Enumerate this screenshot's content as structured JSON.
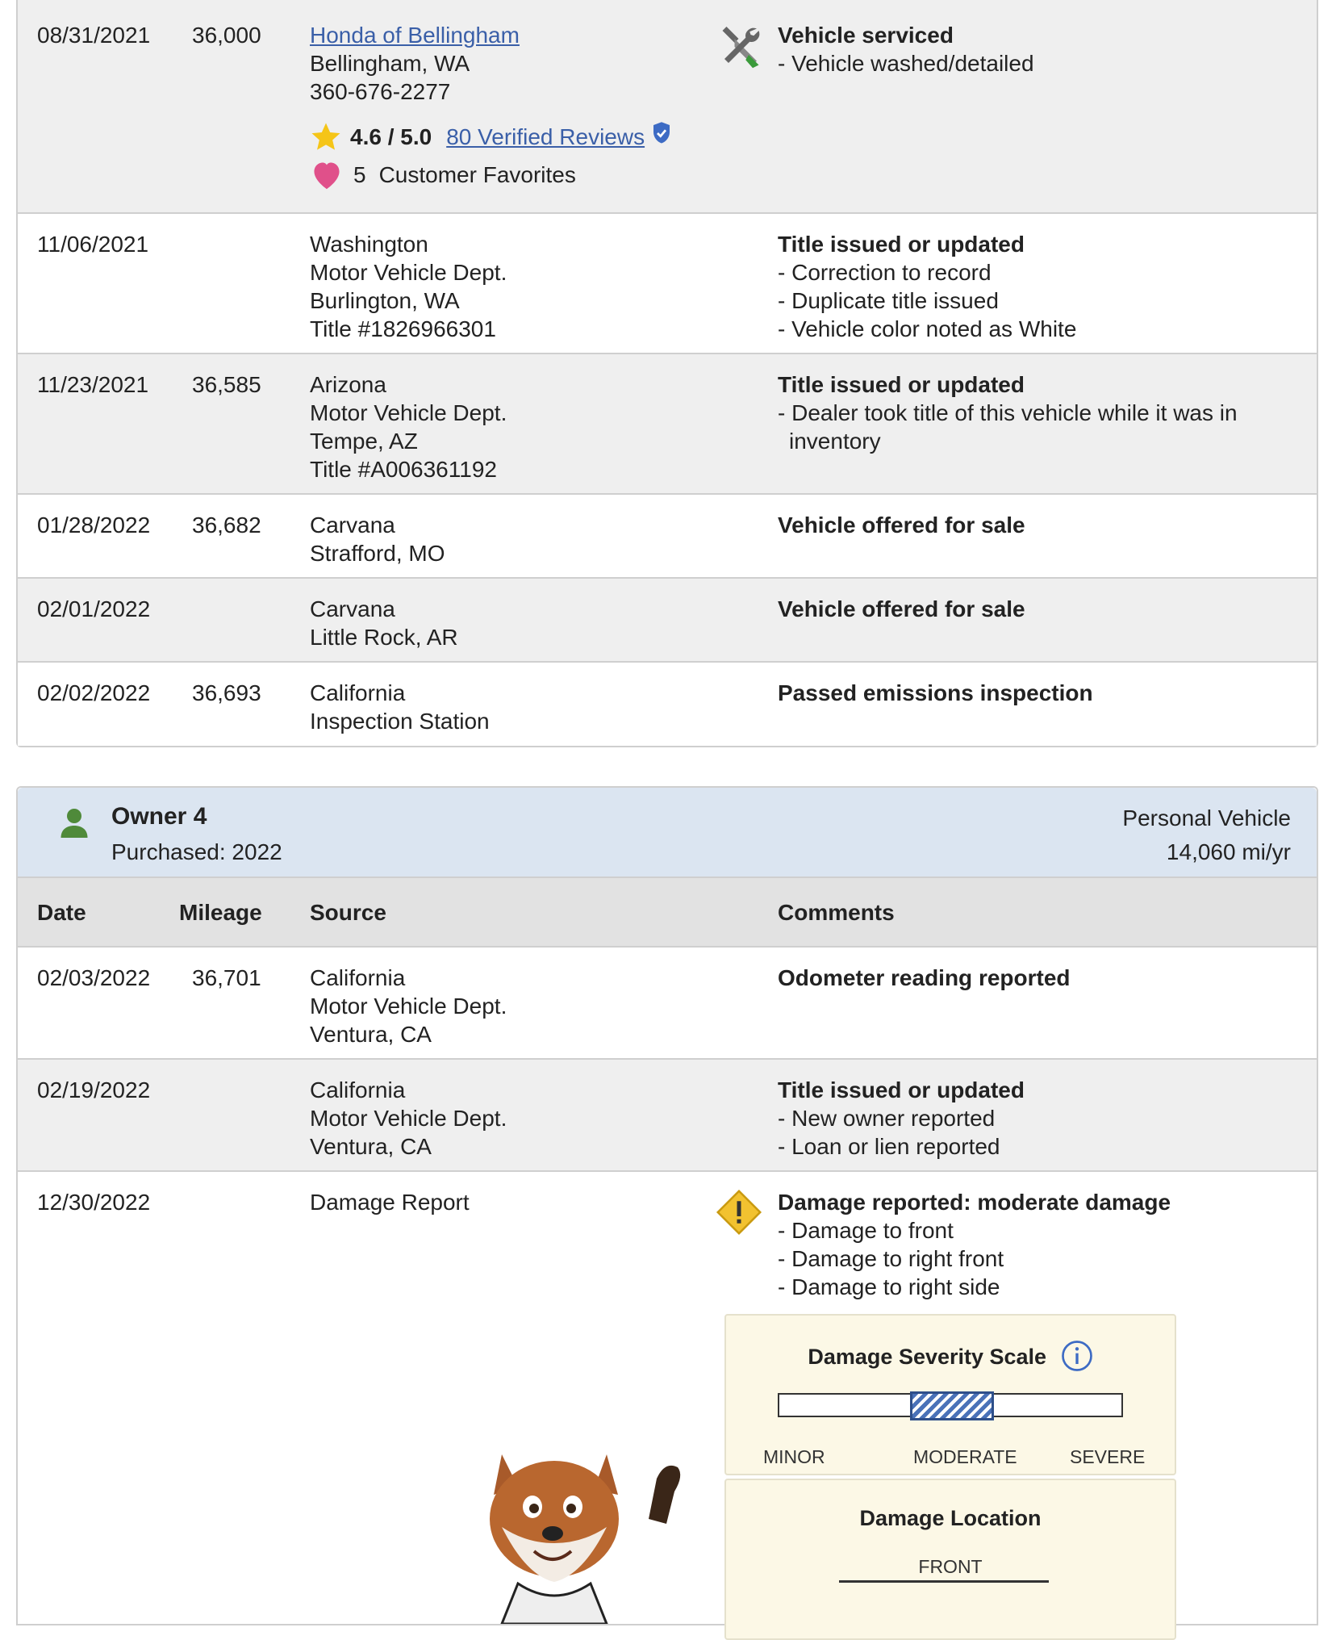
{
  "history_rows": [
    {
      "date": "08/31/2021",
      "mileage": "36,000",
      "source": {
        "link": "Honda of Bellingham",
        "lines": [
          "Bellingham, WA",
          "360-676-2277"
        ],
        "rating": "4.6 / 5.0",
        "reviews_link": "80 Verified Reviews",
        "favorites_count": "5",
        "favorites_label": "Customer Favorites"
      },
      "icon": "service-tools-icon",
      "comment_title": "Vehicle serviced",
      "comment_items": [
        "- Vehicle washed/detailed"
      ]
    },
    {
      "date": "11/06/2021",
      "mileage": "",
      "source_lines": [
        "Washington",
        "Motor Vehicle Dept.",
        "Burlington, WA",
        "Title #1826966301"
      ],
      "comment_title": "Title issued or updated",
      "comment_items": [
        "- Correction to record",
        "- Duplicate title issued",
        "- Vehicle color noted as White"
      ]
    },
    {
      "date": "11/23/2021",
      "mileage": "36,585",
      "source_lines": [
        "Arizona",
        "Motor Vehicle Dept.",
        "Tempe, AZ",
        "Title #A006361192"
      ],
      "comment_title": "Title issued or updated",
      "comment_items": [
        "- Dealer took title of this vehicle while it was in inventory"
      ]
    },
    {
      "date": "01/28/2022",
      "mileage": "36,682",
      "source_lines": [
        "Carvana",
        "Strafford, MO"
      ],
      "comment_title": "Vehicle offered for sale",
      "comment_items": []
    },
    {
      "date": "02/01/2022",
      "mileage": "",
      "source_lines": [
        "Carvana",
        "Little Rock, AR"
      ],
      "comment_title": "Vehicle offered for sale",
      "comment_items": []
    },
    {
      "date": "02/02/2022",
      "mileage": "36,693",
      "source_lines": [
        "California",
        "Inspection Station"
      ],
      "comment_title": "Passed emissions inspection",
      "comment_items": []
    }
  ],
  "owner": {
    "title": "Owner 4",
    "purchased": "Purchased: 2022",
    "vehicle_type": "Personal Vehicle",
    "annual_miles": "14,060 mi/yr",
    "icon": "person-icon"
  },
  "columns": {
    "date": "Date",
    "mileage": "Mileage",
    "source": "Source",
    "comments": "Comments"
  },
  "owner_rows": [
    {
      "date": "02/03/2022",
      "mileage": "36,701",
      "source_lines": [
        "California",
        "Motor Vehicle Dept.",
        "Ventura, CA"
      ],
      "comment_title": "Odometer reading reported",
      "comment_items": []
    },
    {
      "date": "02/19/2022",
      "mileage": "",
      "source_lines": [
        "California",
        "Motor Vehicle Dept.",
        "Ventura, CA"
      ],
      "comment_title": "Title issued or updated",
      "comment_items": [
        "- New owner reported",
        "- Loan or lien reported"
      ]
    },
    {
      "date": "12/30/2022",
      "mileage": "",
      "source_lines": [
        "Damage Report"
      ],
      "icon": "warning-diamond-icon",
      "comment_title": "Damage reported: moderate damage",
      "comment_items": [
        "- Damage to front",
        "- Damage to right front",
        "- Damage to right side"
      ]
    }
  ],
  "damage_severity": {
    "title": "Damage Severity Scale",
    "levels": [
      "MINOR",
      "MODERATE",
      "SEVERE"
    ],
    "selected": "MODERATE",
    "icon": "info-icon"
  },
  "damage_location": {
    "title": "Damage Location",
    "front_label": "FRONT"
  },
  "mascot": "fox-mascot-icon",
  "colors": {
    "link": "#3a5fa8",
    "owner_header_bg": "#dbe5f1",
    "row_shaded": "#efefef",
    "star": "#f5c518",
    "heart": "#e0508a",
    "verified_shield": "#3d6bc4",
    "warning": "#f2c230",
    "person": "#4f8a3a"
  }
}
